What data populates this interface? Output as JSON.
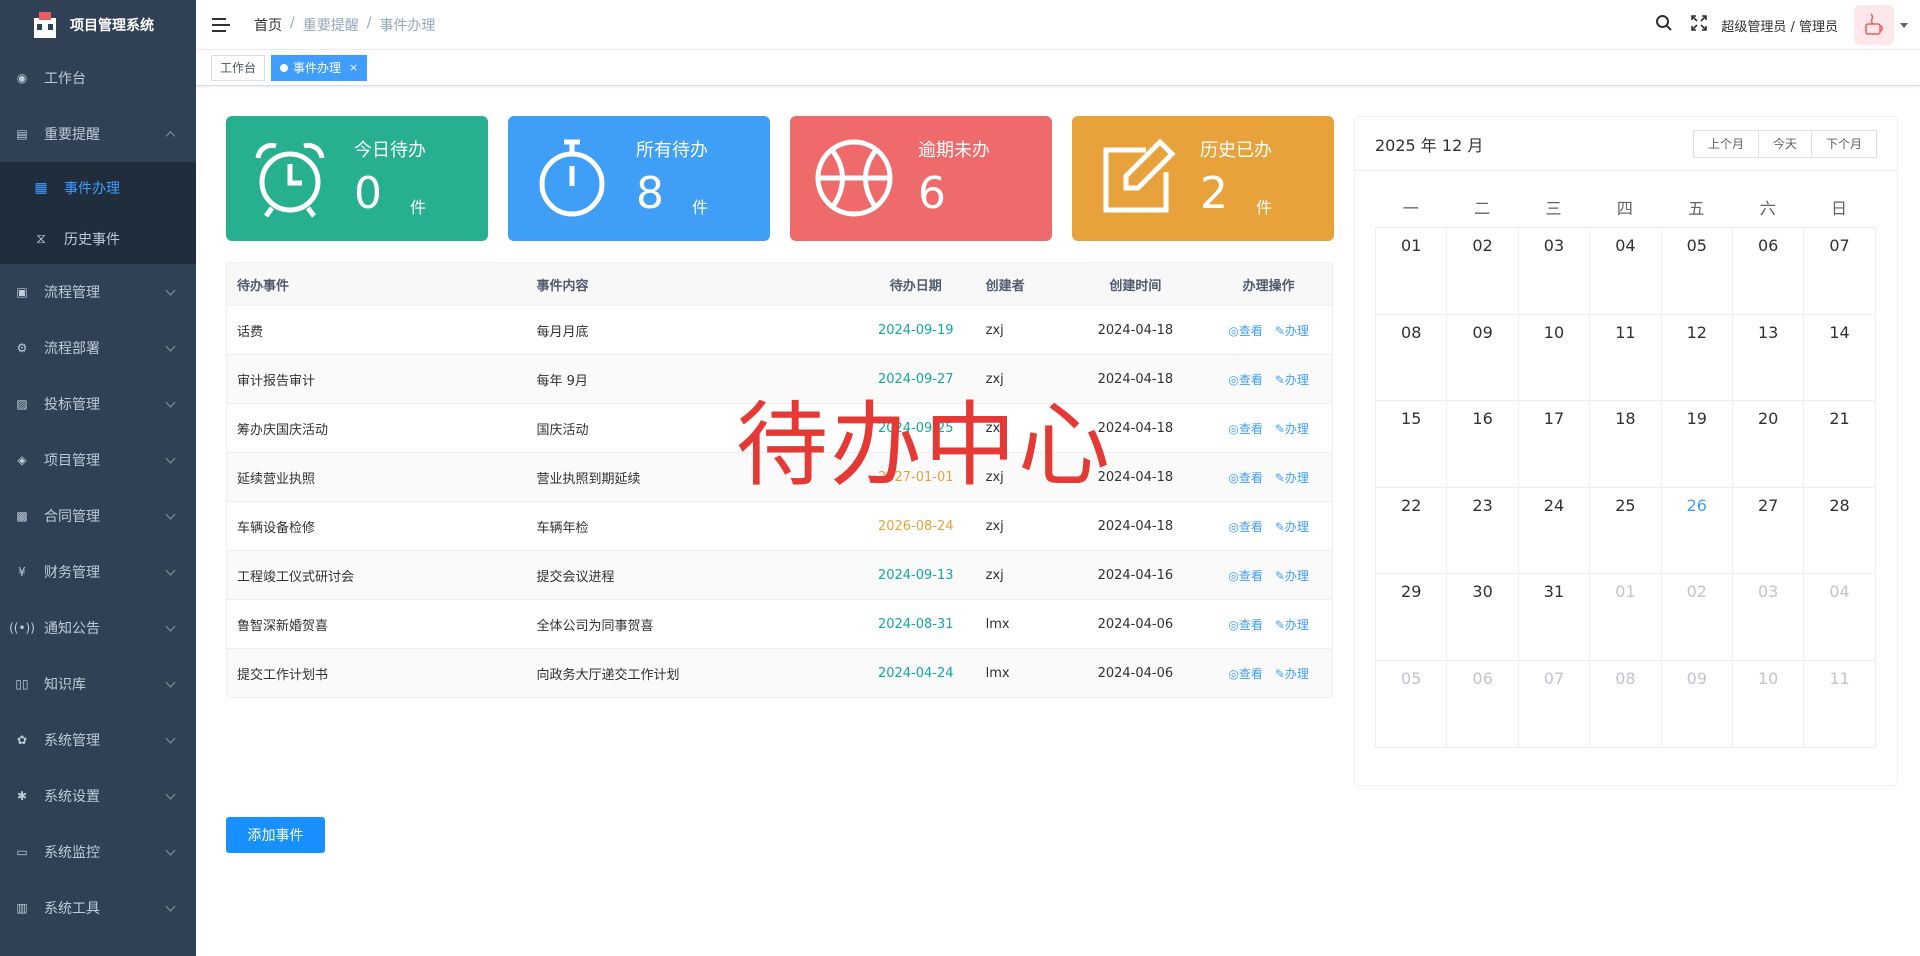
{
  "app": {
    "title": "项目管理系统"
  },
  "sidebar": {
    "items": [
      {
        "label": "工作台",
        "icon": "dashboard-icon"
      },
      {
        "label": "重要提醒",
        "icon": "reminder-icon",
        "expanded": true,
        "children": [
          {
            "label": "事件办理",
            "icon": "grid-icon",
            "active": true
          },
          {
            "label": "历史事件",
            "icon": "history-icon"
          }
        ]
      },
      {
        "label": "流程管理",
        "icon": "flow-icon"
      },
      {
        "label": "流程部署",
        "icon": "deploy-icon"
      },
      {
        "label": "投标管理",
        "icon": "bid-icon"
      },
      {
        "label": "项目管理",
        "icon": "project-icon"
      },
      {
        "label": "合同管理",
        "icon": "contract-icon"
      },
      {
        "label": "财务管理",
        "icon": "yen-icon"
      },
      {
        "label": "通知公告",
        "icon": "broadcast-icon"
      },
      {
        "label": "知识库",
        "icon": "book-icon"
      },
      {
        "label": "系统管理",
        "icon": "gear-icon"
      },
      {
        "label": "系统设置",
        "icon": "settings-icon"
      },
      {
        "label": "系统监控",
        "icon": "monitor-icon"
      },
      {
        "label": "系统工具",
        "icon": "toolbox-icon"
      }
    ]
  },
  "breadcrumb": [
    "首页",
    "重要提醒",
    "事件办理"
  ],
  "header": {
    "user": "超级管理员 / 管理员"
  },
  "tags": [
    {
      "label": "工作台",
      "active": false
    },
    {
      "label": "事件办理",
      "active": true,
      "close": "×"
    }
  ],
  "cards": [
    {
      "label": "今日待办",
      "count": "0",
      "unit": "件",
      "color": "#26b08f",
      "icon": "alarm-clock-icon"
    },
    {
      "label": "所有待办",
      "count": "8",
      "unit": "件",
      "color": "#3f9ef5",
      "icon": "stopwatch-icon"
    },
    {
      "label": "逾期未办",
      "count": "6",
      "unit": "",
      "color": "#ef6b6b",
      "icon": "basketball-icon"
    },
    {
      "label": "历史已办",
      "count": "2",
      "unit": "件",
      "color": "#e8a23c",
      "icon": "edit-icon"
    }
  ],
  "table": {
    "headers": [
      "待办事件",
      "事件内容",
      "待办日期",
      "创建者",
      "创建时间",
      "办理操作"
    ],
    "rows": [
      {
        "event": "话费",
        "content": "每月月底",
        "due": "2024-09-19",
        "due_status": "green",
        "creator": "zxj",
        "created": "2024-04-18"
      },
      {
        "event": "审计报告审计",
        "content": "每年 9月",
        "due": "2024-09-27",
        "due_status": "green",
        "creator": "zxj",
        "created": "2024-04-18"
      },
      {
        "event": "筹办庆国庆活动",
        "content": "国庆活动",
        "due": "2024-09-25",
        "due_status": "green",
        "creator": "zxj",
        "created": "2024-04-18"
      },
      {
        "event": "延续营业执照",
        "content": "营业执照到期延续",
        "due": "2027-01-01",
        "due_status": "orange",
        "creator": "zxj",
        "created": "2024-04-18"
      },
      {
        "event": "车辆设备检修",
        "content": "车辆年检",
        "due": "2026-08-24",
        "due_status": "orange",
        "creator": "zxj",
        "created": "2024-04-18"
      },
      {
        "event": "工程竣工仪式研讨会",
        "content": "提交会议进程",
        "due": "2024-09-13",
        "due_status": "green",
        "creator": "zxj",
        "created": "2024-04-16"
      },
      {
        "event": "鲁智深新婚贺喜",
        "content": "全体公司为同事贺喜",
        "due": "2024-08-31",
        "due_status": "green",
        "creator": "lmx",
        "created": "2024-04-06"
      },
      {
        "event": "提交工作计划书",
        "content": "向政务大厅递交工作计划",
        "due": "2024-04-24",
        "due_status": "green",
        "creator": "lmx",
        "created": "2024-04-06"
      }
    ],
    "view_label": "查看",
    "handle_label": "办理"
  },
  "watermark": "待办中心",
  "add_button": "添加事件",
  "calendar": {
    "title": "2025 年 12 月",
    "buttons": [
      "上个月",
      "今天",
      "下个月"
    ],
    "weekdays": [
      "一",
      "二",
      "三",
      "四",
      "五",
      "六",
      "日"
    ],
    "weeks": [
      [
        "01",
        "02",
        "03",
        "04",
        "05",
        "06",
        "07"
      ],
      [
        "08",
        "09",
        "10",
        "11",
        "12",
        "13",
        "14"
      ],
      [
        "15",
        "16",
        "17",
        "18",
        "19",
        "20",
        "21"
      ],
      [
        "22",
        "23",
        "24",
        "25",
        "26",
        "27",
        "28"
      ],
      [
        "29",
        "30",
        "31",
        "01",
        "02",
        "03",
        "04"
      ],
      [
        "05",
        "06",
        "07",
        "08",
        "09",
        "10",
        "11"
      ]
    ],
    "today": "26"
  }
}
